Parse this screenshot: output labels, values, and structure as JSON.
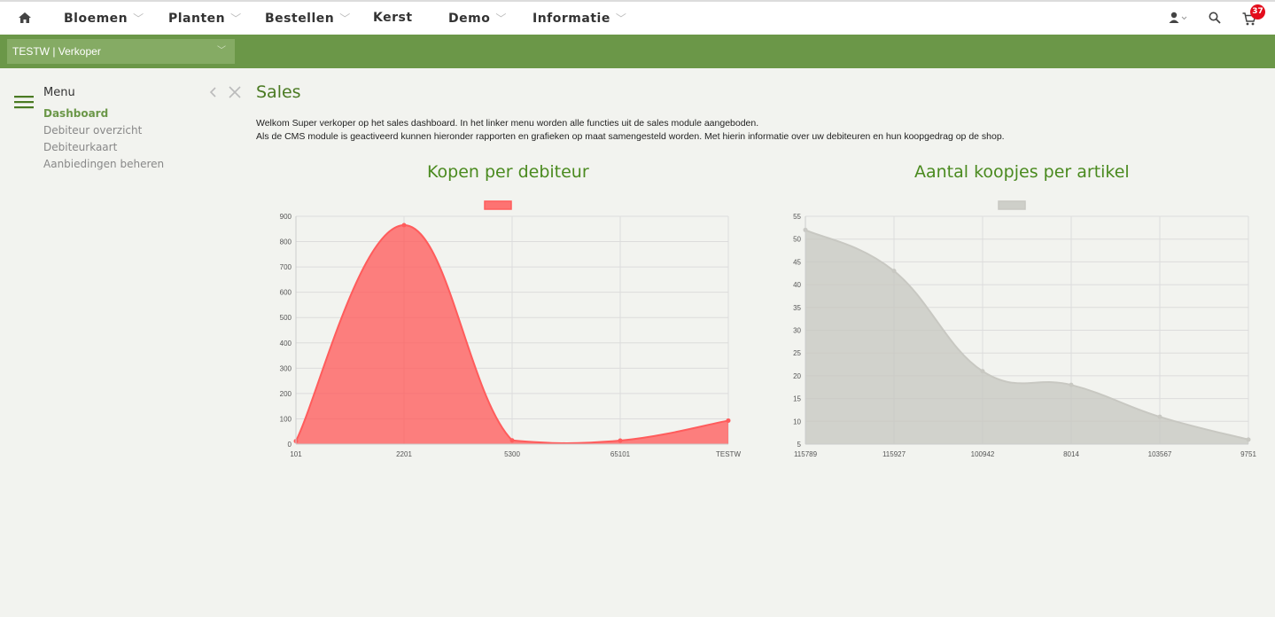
{
  "nav": {
    "items": [
      {
        "label": "Bloemen",
        "dropdown": true
      },
      {
        "label": "Planten",
        "dropdown": true
      },
      {
        "label": "Bestellen",
        "dropdown": true
      },
      {
        "label": "Kerst",
        "dropdown": false
      },
      {
        "label": "Demo",
        "dropdown": true
      },
      {
        "label": "Informatie",
        "dropdown": true
      }
    ],
    "cart_count": "37",
    "icons": [
      "home-icon",
      "user-icon",
      "search-icon",
      "cart-icon"
    ]
  },
  "account": {
    "selected": "TESTW | Verkoper"
  },
  "sidebar": {
    "title": "Menu",
    "items": [
      {
        "label": "Dashboard",
        "active": true
      },
      {
        "label": "Debiteur overzicht",
        "active": false
      },
      {
        "label": "Debiteurkaart",
        "active": false
      },
      {
        "label": "Aanbiedingen beheren",
        "active": false
      }
    ]
  },
  "page": {
    "title": "Sales",
    "intro_line1": "Welkom Super verkoper op het sales dashboard. In het linker menu worden alle functies uit de sales module aangeboden.",
    "intro_line2": "Als de CMS module is geactiveerd kunnen hieronder rapporten en grafieken op maat samengesteld worden. Met hierin informatie over uw debiteuren en hun koopgedrag op de shop."
  },
  "colors": {
    "accent": "#6b9748",
    "chart1": "#ff5c5c",
    "chart2": "#c8c8c2"
  },
  "chart_data": [
    {
      "type": "area",
      "title": "Kopen per debiteur",
      "categories": [
        "101",
        "2201",
        "5300",
        "65101",
        "TESTW"
      ],
      "series": [
        {
          "values": [
            12,
            865,
            15,
            14,
            93
          ],
          "color": "#ff5c5c"
        }
      ],
      "ylim": [
        0,
        900
      ],
      "yticks": [
        0,
        100,
        200,
        300,
        400,
        500,
        600,
        700,
        800,
        900
      ],
      "grid": true,
      "legend": "top-center"
    },
    {
      "type": "area",
      "title": "Aantal koopjes per artikel",
      "categories": [
        "115789",
        "115927",
        "100942",
        "8014",
        "103567",
        "9751"
      ],
      "series": [
        {
          "values": [
            52,
            43,
            21,
            18,
            11,
            6
          ],
          "color": "#c8c8c2"
        }
      ],
      "ylim": [
        5,
        55
      ],
      "yticks": [
        5,
        10,
        15,
        20,
        25,
        30,
        35,
        40,
        45,
        50,
        55
      ],
      "grid": true,
      "legend": "top-center"
    }
  ]
}
